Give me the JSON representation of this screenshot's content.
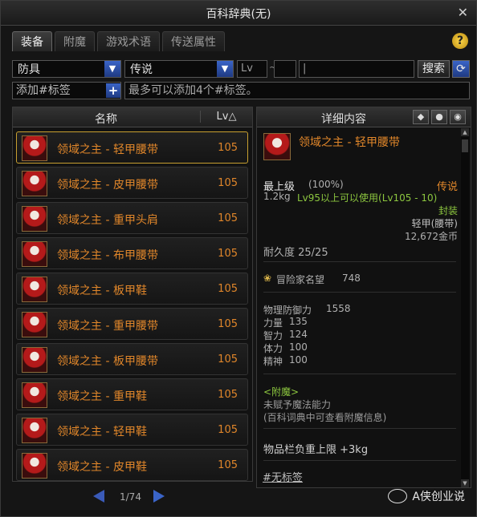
{
  "window": {
    "title": "百科辞典(无)",
    "close": "✕"
  },
  "tabs": [
    {
      "label": "装备",
      "active": true
    },
    {
      "label": "附魔",
      "active": false
    },
    {
      "label": "游戏术语",
      "active": false
    },
    {
      "label": "传送属性",
      "active": false
    }
  ],
  "help": "?",
  "filters": {
    "category": "防具",
    "rarity": "传说",
    "lv_label": "Lv",
    "lv_sep": "~",
    "search_button": "搜索",
    "refresh_icon": "refresh-icon"
  },
  "tags": {
    "add_label": "添加#标签",
    "hint": "最多可以添加4个#标签。"
  },
  "list": {
    "header_name": "名称",
    "header_lv": "Lv△",
    "items": [
      {
        "name": "领域之主 - 轻甲腰带",
        "lv": "105"
      },
      {
        "name": "领域之主 - 皮甲腰带",
        "lv": "105"
      },
      {
        "name": "领域之主 - 重甲头肩",
        "lv": "105"
      },
      {
        "name": "领域之主 - 布甲腰带",
        "lv": "105"
      },
      {
        "name": "领域之主 - 板甲鞋",
        "lv": "105"
      },
      {
        "name": "领域之主 - 重甲腰带",
        "lv": "105"
      },
      {
        "name": "领域之主 - 板甲腰带",
        "lv": "105"
      },
      {
        "name": "领域之主 - 重甲鞋",
        "lv": "105"
      },
      {
        "name": "领域之主 - 轻甲鞋",
        "lv": "105"
      },
      {
        "name": "领域之主 - 皮甲鞋",
        "lv": "105"
      }
    ],
    "page": "1/74"
  },
  "detail": {
    "header": "详细内容",
    "name": "领域之主 - 轻甲腰带",
    "grade": "最上级",
    "grade_pct": "(100%)",
    "rarity": "传说",
    "weight": "1.2kg",
    "usable": "Lv95以上可以使用(Lv105 - 10)",
    "seal": "封装",
    "type": "轻甲(腰带)",
    "price": "12,672金币",
    "durability": "耐久度 25/25",
    "fame_label": "冒险家名望",
    "fame_value": "748",
    "stats": [
      {
        "label": "物理防御力",
        "value": "1558"
      },
      {
        "label": "力量",
        "value": "135"
      },
      {
        "label": "智力",
        "value": "124"
      },
      {
        "label": "体力",
        "value": "100"
      },
      {
        "label": "精神",
        "value": "100"
      }
    ],
    "enchant_title": "<附魔>",
    "enchant_line1": "未赋予魔法能力",
    "enchant_line2": "(百科词典中可查看附魔信息)",
    "inv_weight": "物品栏负重上限 +3kg",
    "no_tag": "#无标签"
  },
  "watermark": "A侠创业说",
  "colors": {
    "accent": "#e0862a",
    "select_border": "#c8a030",
    "button_blue": "#3a64c8"
  }
}
